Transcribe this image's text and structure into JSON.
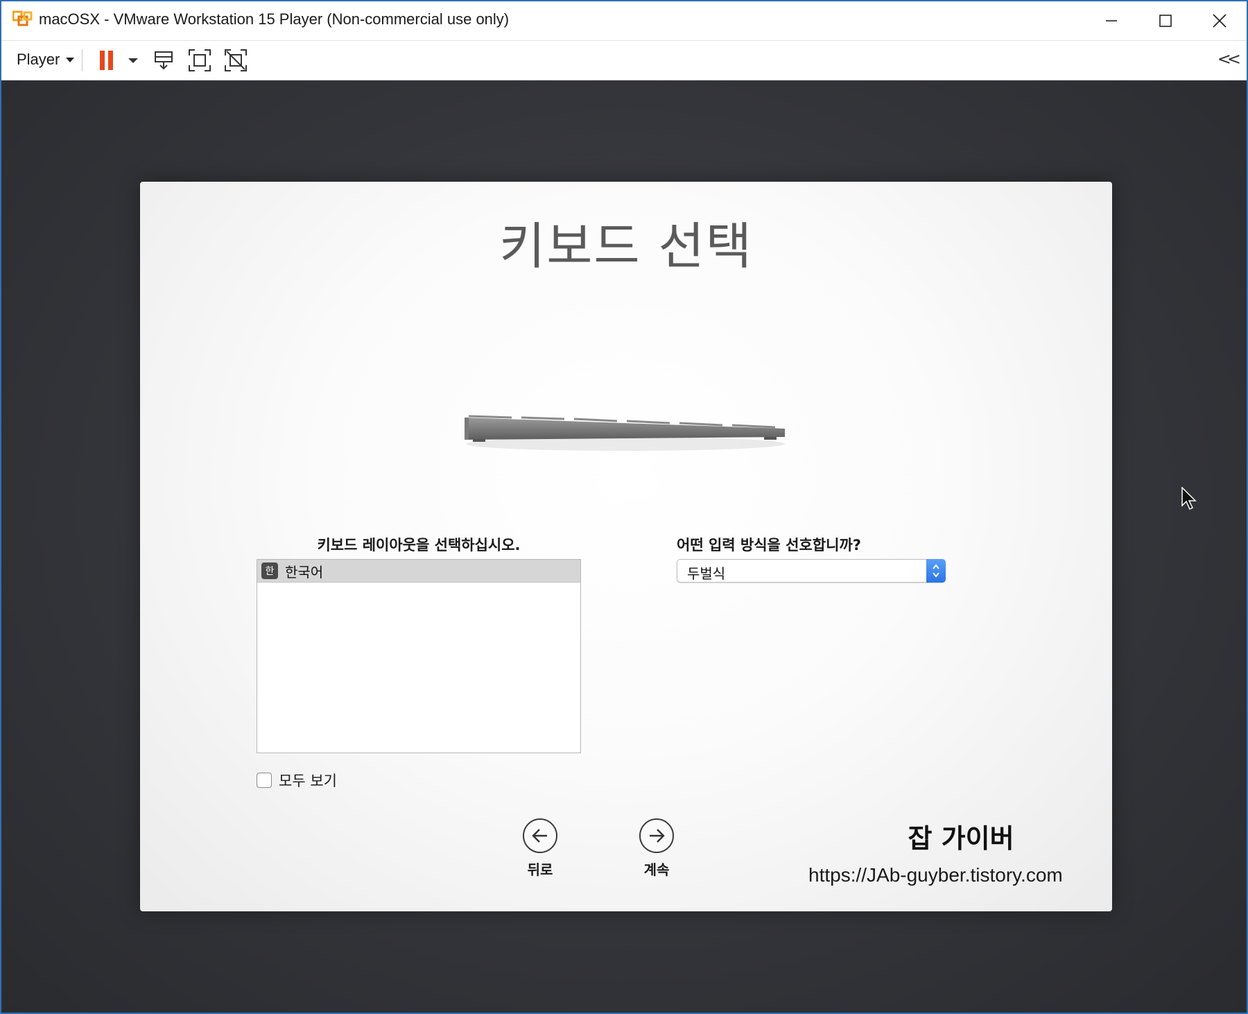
{
  "window": {
    "title": "macOSX - VMware Workstation 15 Player (Non-commercial use only)",
    "controls": [
      "minimize",
      "maximize",
      "close"
    ]
  },
  "toolbar": {
    "player_label": "Player",
    "icons": [
      "pause-icon",
      "dropdown-arrow-icon",
      "send-ctrl-alt-del-icon",
      "fullscreen-icon",
      "unity-icon"
    ],
    "collapse_label": "<<"
  },
  "setup": {
    "title": "키보드 선택",
    "layout_prompt": "키보드 레이아웃을 선택하십시오.",
    "layouts": [
      {
        "badge": "한",
        "label": "한국어",
        "selected": true
      }
    ],
    "show_all_label": "모두 보기",
    "show_all_checked": false,
    "input_prompt": "어떤 입력 방식을 선호합니까?",
    "input_method": "두벌식",
    "back_label": "뒤로",
    "continue_label": "계속"
  },
  "watermark": {
    "title": "잡 가이버",
    "url": "https://JAb-guyber.tistory.com"
  },
  "colors": {
    "window_border": "#2f6fb3",
    "pause_accent": "#e8471b",
    "select_accent": "#2a74e8"
  }
}
